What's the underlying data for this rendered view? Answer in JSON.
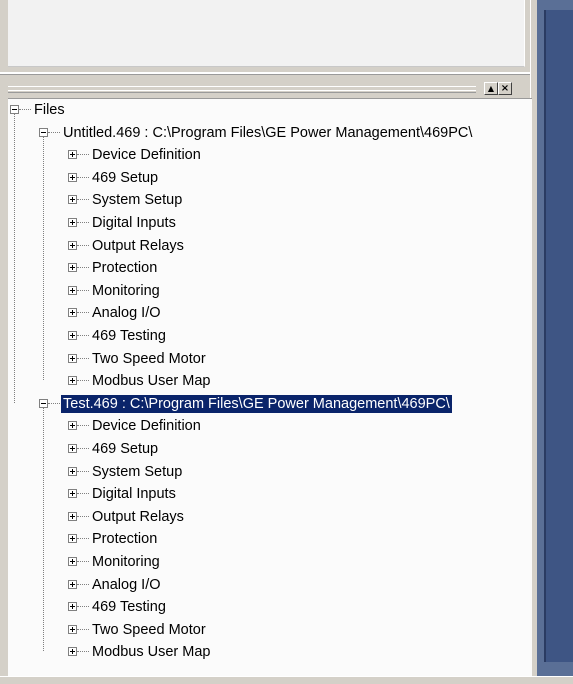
{
  "tree": {
    "root": "Files",
    "devices": [
      {
        "label": "Untitled.469 : C:\\Program Files\\GE Power Management\\469PC\\",
        "selected": false,
        "children": [
          "Device Definition",
          "469 Setup",
          "System Setup",
          "Digital Inputs",
          "Output Relays",
          "Protection",
          "Monitoring",
          "Analog I/O",
          "469 Testing",
          "Two Speed Motor",
          "Modbus User Map"
        ]
      },
      {
        "label": "Test.469 : C:\\Program Files\\GE Power Management\\469PC\\",
        "selected": true,
        "children": [
          "Device Definition",
          "469 Setup",
          "System Setup",
          "Digital Inputs",
          "Output Relays",
          "Protection",
          "Monitoring",
          "Analog I/O",
          "469 Testing",
          "Two Speed Motor",
          "Modbus User Map"
        ]
      }
    ]
  },
  "panel": {
    "restore_icon": "triangle-up-icon",
    "close_icon": "close-icon"
  },
  "colors": {
    "selection": "#0a246a",
    "workspace": "#3e5584"
  }
}
